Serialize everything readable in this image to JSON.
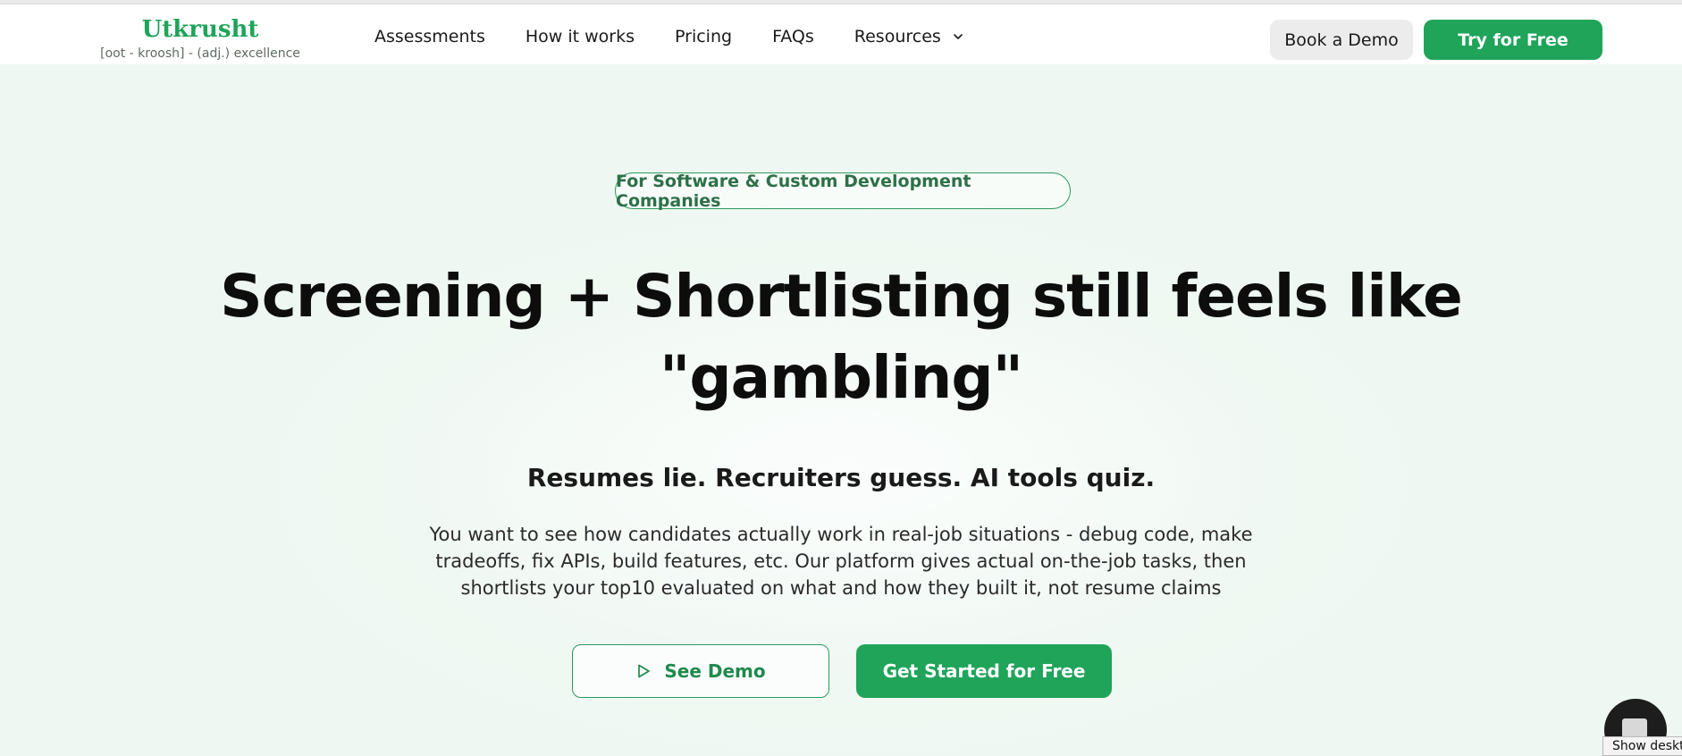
{
  "brand": {
    "name": "Utkrusht",
    "tagline": "[oot - kroosh] - (adj.) excellence",
    "accent_color": "#1fa45a"
  },
  "nav": {
    "items": [
      {
        "label": "Assessments"
      },
      {
        "label": "How it works"
      },
      {
        "label": "Pricing"
      },
      {
        "label": "FAQs"
      },
      {
        "label": "Resources",
        "icon": "chevron-down-icon"
      }
    ],
    "book_demo_label": "Book a Demo",
    "try_free_label": "Try for Free"
  },
  "hero": {
    "badge": "For Software & Custom Development Companies",
    "headline_line1": "Screening + Shortlisting still feels like",
    "headline_line2": "\"gambling\"",
    "subheadline": "Resumes lie. Recruiters guess. AI tools quiz.",
    "body_line1": "You want to see how candidates actually work in real-job situations - debug code, make",
    "body_line2": "tradeoffs, fix APIs, build features, etc. Our platform gives actual on-the-job tasks, then",
    "body_line3": "shortlists your top10 evaluated on what and how they built it, not resume claims",
    "see_demo_label": "See Demo",
    "see_demo_icon": "play-icon",
    "get_started_label": "Get Started for Free"
  },
  "widget": {
    "chat_icon": "chat-widget-icon",
    "tooltip": "Show deskt"
  }
}
